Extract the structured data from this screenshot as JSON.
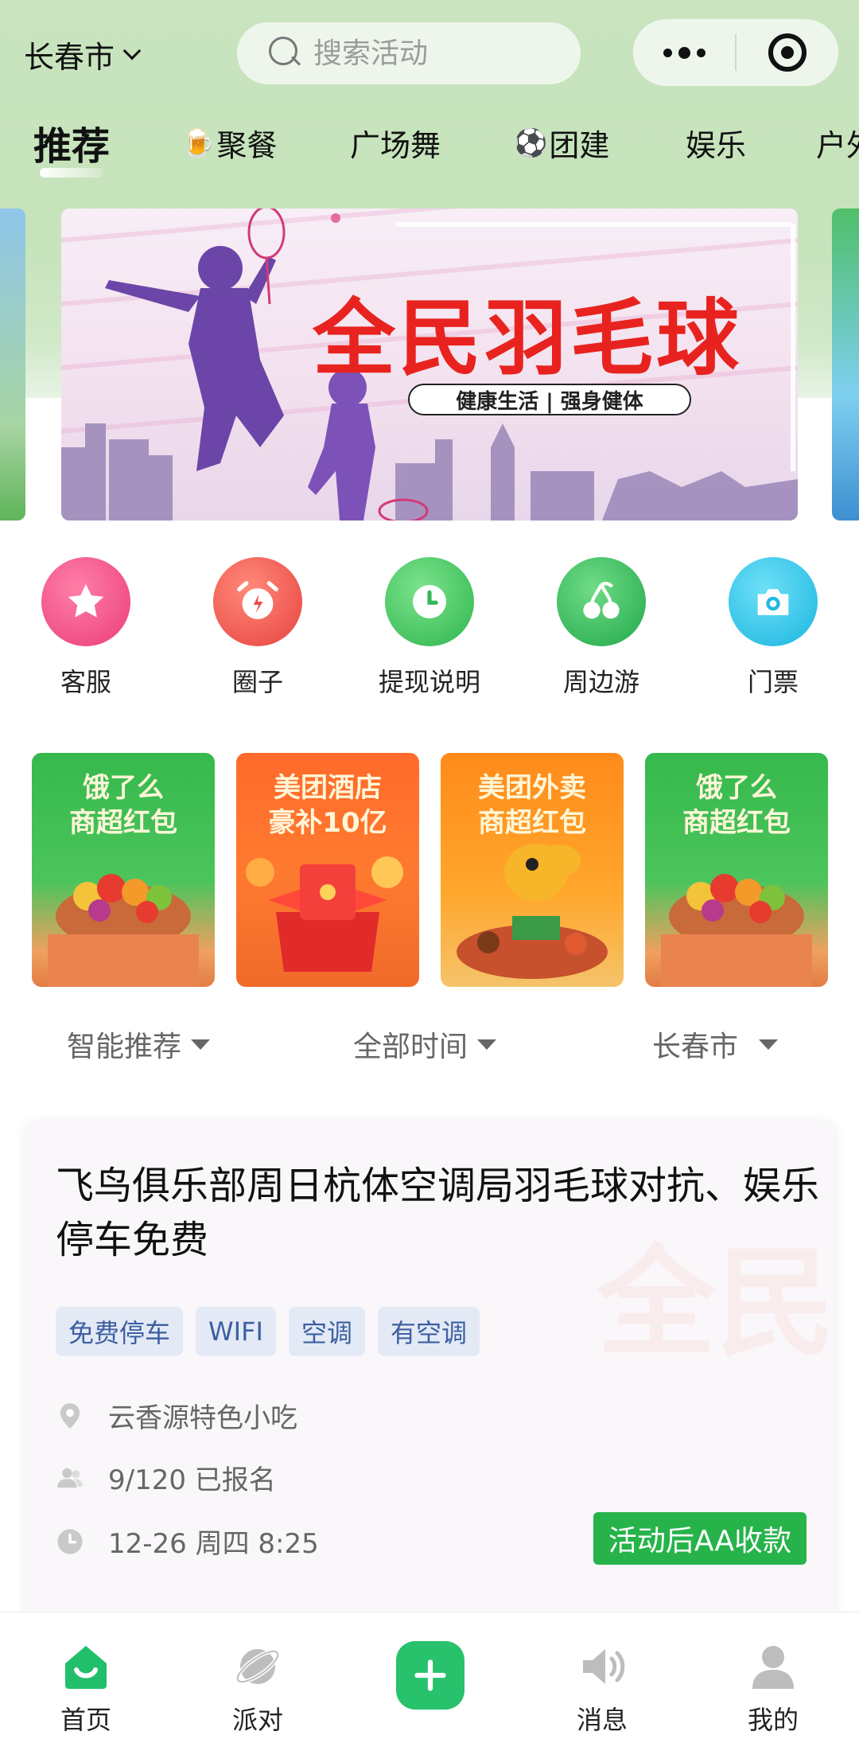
{
  "header": {
    "city": "长春市",
    "search_placeholder": "搜索活动"
  },
  "categories": [
    {
      "label": "推荐",
      "emoji": ""
    },
    {
      "label": "聚餐",
      "emoji": "🍺"
    },
    {
      "label": "广场舞",
      "emoji": ""
    },
    {
      "label": "团建",
      "emoji": "⚽"
    },
    {
      "label": "娱乐",
      "emoji": ""
    },
    {
      "label": "户外",
      "emoji": ""
    }
  ],
  "banner": {
    "title": "全民羽毛球",
    "subtitle": "健康生活 | 强身健体"
  },
  "quick_links": [
    {
      "label": "客服",
      "icon": "star-icon",
      "color": "#ef4f86"
    },
    {
      "label": "圈子",
      "icon": "alarm-clock-icon",
      "color": "#ef5a52"
    },
    {
      "label": "提现说明",
      "icon": "clock-icon",
      "color": "#3ec35e"
    },
    {
      "label": "周边游",
      "icon": "cherry-icon",
      "color": "#36b85a"
    },
    {
      "label": "门票",
      "icon": "camera-icon",
      "color": "#28c2e6"
    }
  ],
  "promos": [
    {
      "line1": "饿了么",
      "line2": "商超红包"
    },
    {
      "line1": "美团酒店",
      "line2": "豪补10亿"
    },
    {
      "line1": "美团外卖",
      "line2": "商超红包"
    },
    {
      "line1": "饿了么",
      "line2": "商超红包"
    }
  ],
  "filters": {
    "sort": "智能推荐",
    "time": "全部时间",
    "city": "长春市"
  },
  "activity": {
    "title": "飞鸟俱乐部周日杭体空调局羽毛球对抗、娱乐停车免费",
    "tags": [
      "免费停车",
      "WIFI",
      "空调",
      "有空调"
    ],
    "location": "云香源特色小吃",
    "signup": "9/120 已报名",
    "time": "12-26 周四 8:25",
    "payment": "活动后AA收款",
    "watermark": "全民"
  },
  "nav": {
    "home": "首页",
    "party": "派对",
    "messages": "消息",
    "mine": "我的"
  },
  "colors": {
    "header_bg": "#c9e4bf",
    "accent_green": "#26b34a",
    "tag_bg": "#e3eaf6",
    "tag_text": "#3d5fa0"
  }
}
